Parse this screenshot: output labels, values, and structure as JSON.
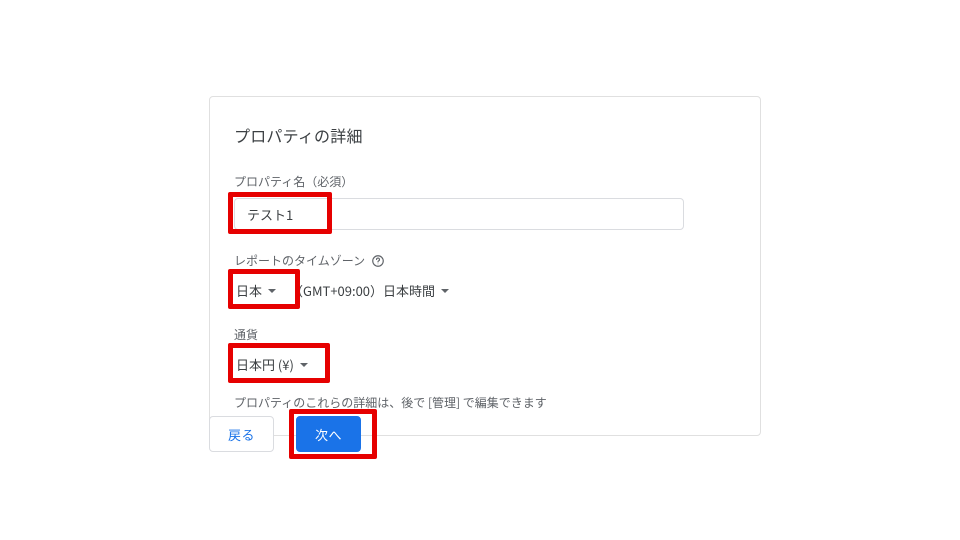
{
  "card": {
    "title": "プロパティの詳細"
  },
  "property_name": {
    "label": "プロパティ名（必須）",
    "value": "テスト1"
  },
  "timezone": {
    "label": "レポートのタイムゾーン",
    "country_value": "日本",
    "gmt_text": "（GMT+09:00）日本時間"
  },
  "currency": {
    "label": "通貨",
    "value": "日本円 (¥)"
  },
  "info_text": "プロパティのこれらの詳細は、後で [管理] で編集できます",
  "buttons": {
    "back": "戻る",
    "next": "次へ"
  }
}
